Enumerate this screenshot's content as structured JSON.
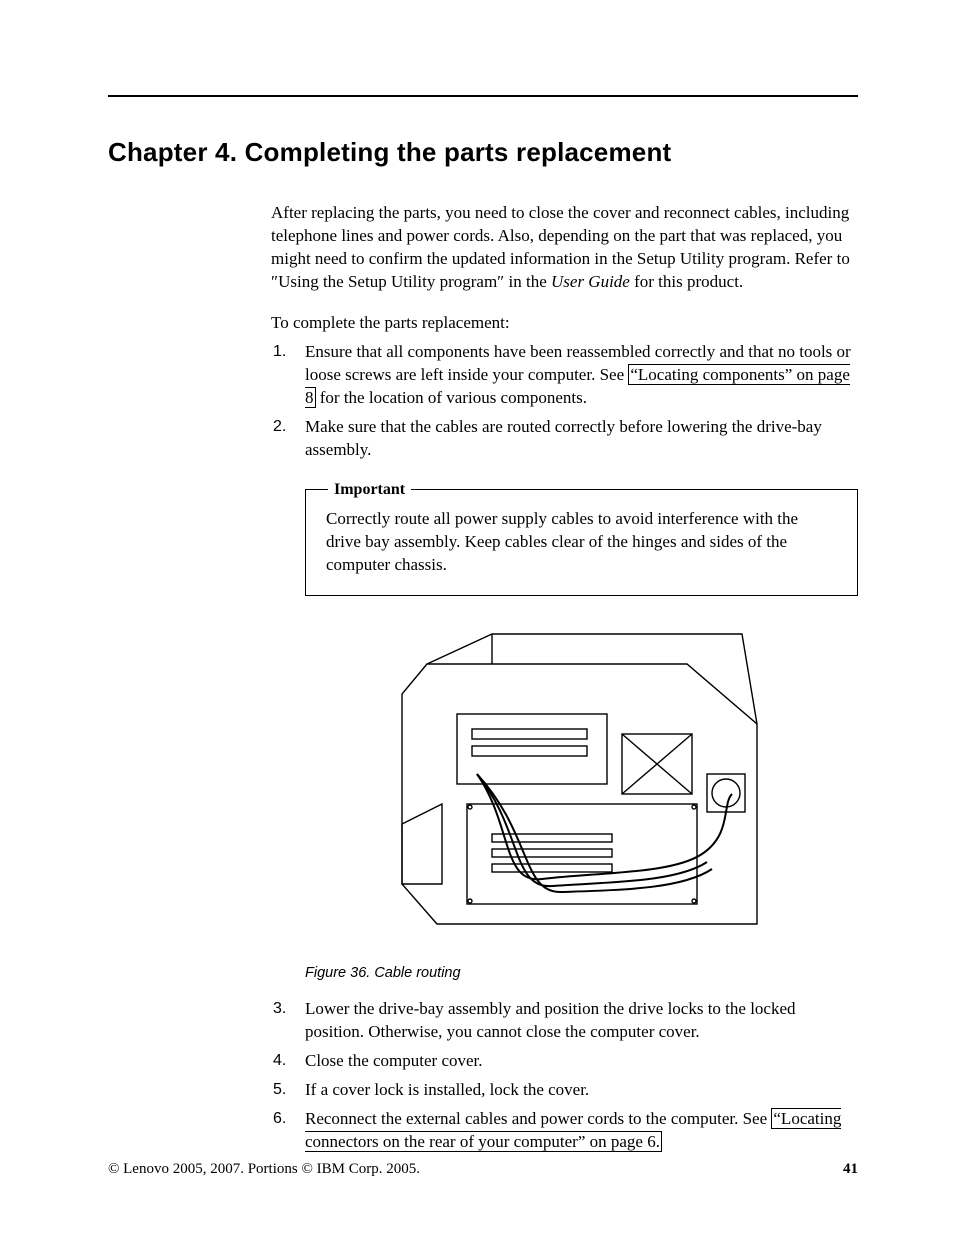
{
  "chapter_title": "Chapter 4. Completing the parts replacement",
  "intro_paragraph": "After replacing the parts, you need to close the cover and reconnect cables, including telephone lines and power cords. Also, depending on the part that was replaced, you might need to confirm the updated information in the Setup Utility program. Refer to ″Using the Setup Utility program″ in the ",
  "intro_paragraph_ital": "User Guide",
  "intro_paragraph_tail": " for this product.",
  "lead_in": "To complete the parts replacement:",
  "steps_a": {
    "s1_pre": "Ensure that all components have been reassembled correctly and that no tools or loose screws are left inside your computer. See ",
    "s1_link": "“Locating components” on page 8",
    "s1_post": " for the location of various components.",
    "s2": "Make sure that the cables are routed correctly before lowering the drive-bay assembly."
  },
  "notice": {
    "legend": "Important",
    "text": "Correctly route all power supply cables to avoid interference with the drive bay assembly. Keep cables clear of the hinges and sides of the computer chassis."
  },
  "figure_caption": "Figure 36. Cable routing",
  "steps_b": {
    "s3": "Lower the drive-bay assembly and position the drive locks to the locked position. Otherwise, you cannot close the computer cover.",
    "s4": "Close the computer cover.",
    "s5": "If a cover lock is installed, lock the cover.",
    "s6_pre": "Reconnect the external cables and power cords to the computer. See ",
    "s6_link": "“Locating connectors on the rear of your computer” on page 6."
  },
  "footer": {
    "copyright": "© Lenovo 2005, 2007. Portions © IBM Corp. 2005.",
    "page_number": "41"
  }
}
